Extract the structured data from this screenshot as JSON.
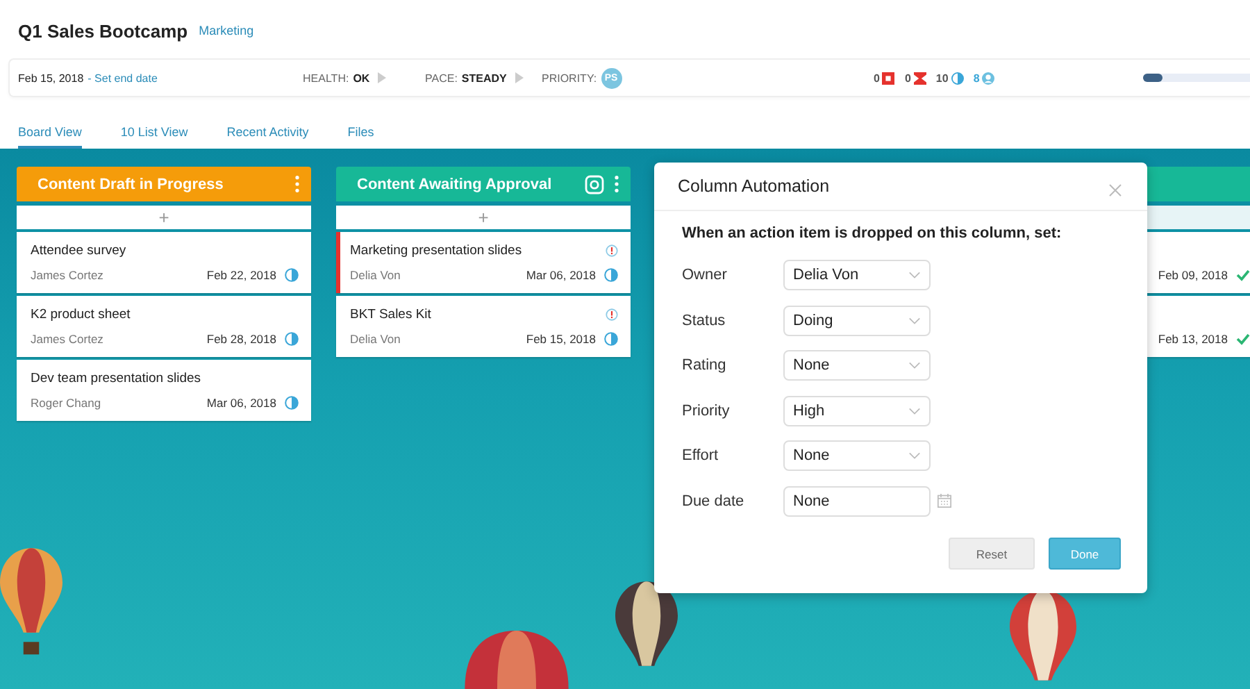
{
  "project": {
    "title": "Q1 Sales Bootcamp",
    "group": "Marketing"
  },
  "info_bar": {
    "start_date": "Feb 15, 2018",
    "end_date_link": "- Set end date",
    "health_label": "HEALTH:",
    "health": "OK",
    "pace_label": "PACE:",
    "pace": "STEADY",
    "priority_label": "PRIORITY:",
    "priority_badge": "PS",
    "counters": [
      {
        "kind": "blocked",
        "value": "0"
      },
      {
        "kind": "overdue",
        "value": "0"
      },
      {
        "kind": "in_progress",
        "value": "10"
      },
      {
        "kind": "people",
        "value": "8"
      }
    ],
    "progress": {
      "level": 0.18
    }
  },
  "tabs": [
    {
      "label": "Board View",
      "selected": true
    },
    {
      "label": "10 List View",
      "selected": false
    },
    {
      "label": "Recent Activity",
      "selected": false
    },
    {
      "label": "Files",
      "selected": false
    }
  ],
  "columns": [
    {
      "title": "Content Draft in Progress",
      "color": "#f59c0a",
      "settings_icon": false,
      "add_label": "+",
      "cards": [
        {
          "title": "Attendee survey",
          "owner": "James Cortez",
          "date": "Feb 22, 2018",
          "kind": "in_progress",
          "alert": false,
          "flagged": false
        },
        {
          "title": "K2 product sheet",
          "owner": "James Cortez",
          "date": "Feb 28, 2018",
          "kind": "in_progress",
          "alert": false,
          "flagged": false
        },
        {
          "title": "Dev team presentation slides",
          "owner": "Roger Chang",
          "date": "Mar 06, 2018",
          "kind": "in_progress",
          "alert": false,
          "flagged": false
        }
      ]
    },
    {
      "title": "Content Awaiting Approval",
      "color": "#17b897",
      "settings_icon": true,
      "add_label": "+",
      "cards": [
        {
          "title": "Marketing presentation slides",
          "owner": "Delia Von",
          "date": "Mar 06, 2018",
          "kind": "in_progress",
          "alert": true,
          "flagged": true
        },
        {
          "title": "BKT Sales Kit",
          "owner": "Delia Von",
          "date": "Feb 15, 2018",
          "kind": "in_progress",
          "alert": true,
          "flagged": false
        }
      ]
    },
    {
      "color": "#17b897",
      "cards": [
        {
          "date": "Feb 09, 2018",
          "kind": "done",
          "alert": false,
          "flagged": false
        },
        {
          "date": "Feb 13, 2018",
          "kind": "done",
          "alert": false,
          "flagged": false
        }
      ]
    }
  ],
  "modal": {
    "title": "Column Automation",
    "instruction": "When an action item is dropped on this column, set:",
    "fields": [
      {
        "label": "Owner",
        "value": "Delia Von",
        "kind": "select"
      },
      {
        "label": "Status",
        "value": "Doing",
        "kind": "select"
      },
      {
        "label": "Rating",
        "value": "None",
        "kind": "select"
      },
      {
        "label": "Priority",
        "value": "High",
        "kind": "select"
      },
      {
        "label": "Effort",
        "value": "None",
        "kind": "select"
      },
      {
        "label": "Due date",
        "value": "None",
        "kind": "date"
      }
    ],
    "buttons": [
      {
        "label": "Reset",
        "kind": "secondary"
      },
      {
        "label": "Done",
        "kind": "primary"
      }
    ]
  }
}
